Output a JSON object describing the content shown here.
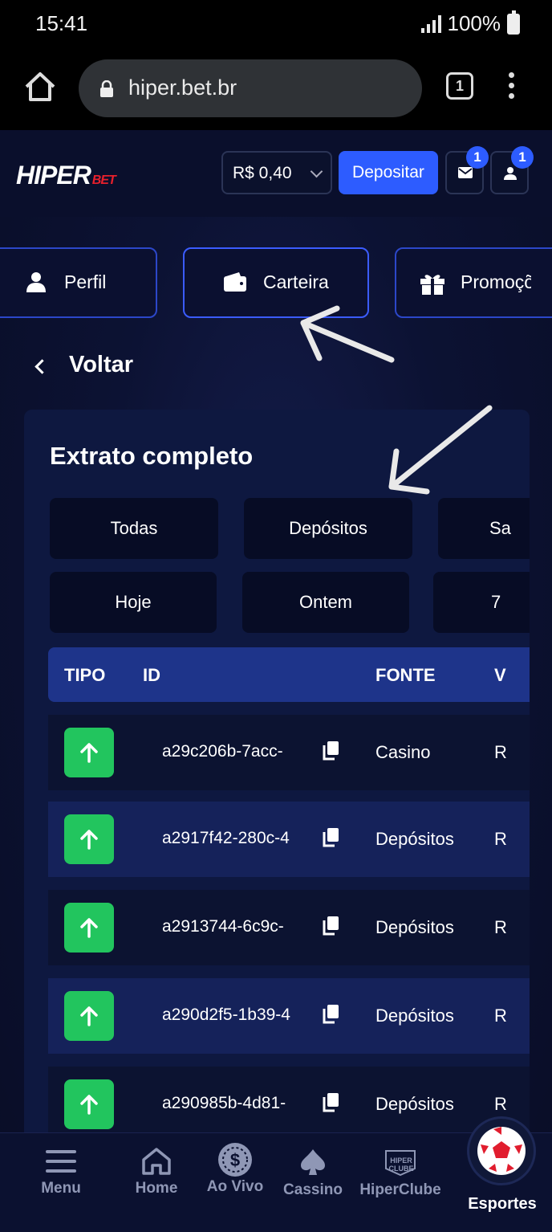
{
  "status_bar": {
    "time": "15:41",
    "battery": "100%"
  },
  "browser": {
    "url": "hiper.bet.br",
    "tab_count": "1"
  },
  "header": {
    "logo_main": "HIPER",
    "logo_sub": "BET",
    "balance": "R$ 0,40",
    "deposit_label": "Depositar",
    "messages_badge": "1",
    "profile_badge": "1"
  },
  "account_nav": {
    "items": [
      {
        "label": "Perfil",
        "icon": "user-icon"
      },
      {
        "label": "Carteira",
        "icon": "wallet-icon"
      },
      {
        "label": "Promoçõ",
        "icon": "gift-icon"
      }
    ]
  },
  "back_label": "Voltar",
  "statement": {
    "title": "Extrato completo",
    "type_filters": [
      "Todas",
      "Depósitos",
      "Sa"
    ],
    "period_filters": [
      "Hoje",
      "Ontem",
      "7"
    ],
    "columns": [
      "TIPO",
      "ID",
      "FONTE",
      "V"
    ],
    "rows": [
      {
        "id": "a29c206b-7acc-",
        "source": "Casino",
        "value": "R"
      },
      {
        "id": "a2917f42-280c-4",
        "source": "Depósitos",
        "value": "R"
      },
      {
        "id": "a2913744-6c9c-",
        "source": "Depósitos",
        "value": "R"
      },
      {
        "id": "a290d2f5-1b39-4",
        "source": "Depósitos",
        "value": "R"
      },
      {
        "id": "a290985b-4d81-",
        "source": "Depósitos",
        "value": "R"
      }
    ]
  },
  "bottom_nav": {
    "items": [
      {
        "label": "Menu",
        "icon": "menu-icon"
      },
      {
        "label": "Home",
        "icon": "home-icon"
      },
      {
        "label": "Ao Vivo",
        "icon": "live-coin-icon"
      },
      {
        "label": "Cassino",
        "icon": "spade-icon"
      },
      {
        "label": "HiperClube",
        "icon": "hiperclube-icon"
      }
    ],
    "esportes_label": "Esportes",
    "hiperclube_badge_text": "HIPER CLUBE"
  },
  "colors": {
    "accent": "#2d5cff",
    "success": "#22c55e",
    "table_header": "#1e348a",
    "background": "#0c1233"
  }
}
